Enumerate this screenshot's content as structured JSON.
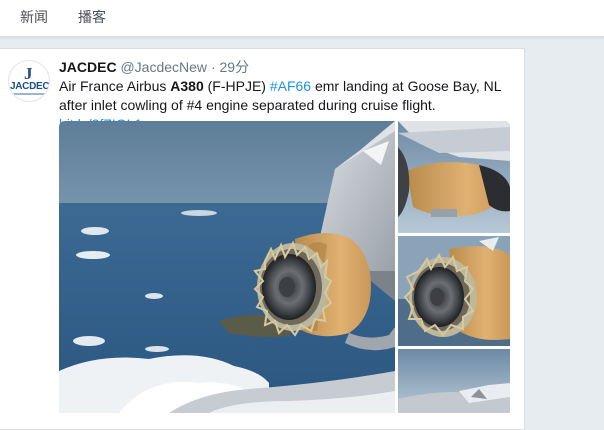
{
  "nav": {
    "items": [
      {
        "label": "新闻"
      },
      {
        "label": "播客"
      }
    ]
  },
  "tweet": {
    "author_name": "JACDEC",
    "handle": "@JacdecNew",
    "separator": "·",
    "time": "29分",
    "avatar": {
      "logo_letter": "J",
      "logo_text": "JACDEC"
    },
    "text": {
      "p1": "Air France Airbus ",
      "b1": "A380",
      "p2": " (F-HPJE) ",
      "hashtag": "#AF66",
      "p3": " emr landing at Goose Bay, NL after inlet cowling of #4 engine separated during cruise flight. ",
      "link": "bit.ly/2fZIOL1"
    },
    "media_icons": {
      "main": "damaged-engine-photo",
      "thumb1": "engine-closeup-photo",
      "thumb2": "engine-fan-photo",
      "thumb3": "wing-photo"
    }
  },
  "colors": {
    "link": "#1b95e0",
    "background": "#e6ecf0",
    "secondary_text": "#657786"
  }
}
